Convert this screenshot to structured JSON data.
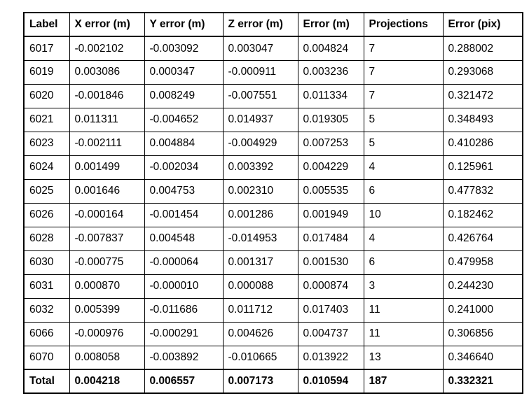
{
  "table": {
    "columns": [
      "Label",
      "X error (m)",
      "Y error (m)",
      "Z error (m)",
      "Error (m)",
      "Projections",
      "Error (pix)"
    ],
    "rows": [
      [
        "6017",
        "-0.002102",
        "-0.003092",
        "0.003047",
        "0.004824",
        "7",
        "0.288002"
      ],
      [
        "6019",
        "0.003086",
        "0.000347",
        "-0.000911",
        "0.003236",
        "7",
        "0.293068"
      ],
      [
        "6020",
        "-0.001846",
        "0.008249",
        "-0.007551",
        "0.011334",
        "7",
        "0.321472"
      ],
      [
        "6021",
        "0.011311",
        "-0.004652",
        "0.014937",
        "0.019305",
        "5",
        "0.348493"
      ],
      [
        "6023",
        "-0.002111",
        "0.004884",
        "-0.004929",
        "0.007253",
        "5",
        "0.410286"
      ],
      [
        "6024",
        "0.001499",
        "-0.002034",
        "0.003392",
        "0.004229",
        "4",
        "0.125961"
      ],
      [
        "6025",
        "0.001646",
        "0.004753",
        "0.002310",
        "0.005535",
        "6",
        "0.477832"
      ],
      [
        "6026",
        "-0.000164",
        "-0.001454",
        "0.001286",
        "0.001949",
        "10",
        "0.182462"
      ],
      [
        "6028",
        "-0.007837",
        "0.004548",
        "-0.014953",
        "0.017484",
        "4",
        "0.426764"
      ],
      [
        "6030",
        "-0.000775",
        "-0.000064",
        "0.001317",
        "0.001530",
        "6",
        "0.479958"
      ],
      [
        "6031",
        "0.000870",
        "-0.000010",
        "0.000088",
        "0.000874",
        "3",
        "0.244230"
      ],
      [
        "6032",
        "0.005399",
        "-0.011686",
        "0.011712",
        "0.017403",
        "11",
        "0.241000"
      ],
      [
        "6066",
        "-0.000976",
        "-0.000291",
        "0.004626",
        "0.004737",
        "11",
        "0.306856"
      ],
      [
        "6070",
        "0.008058",
        "-0.003892",
        "-0.010665",
        "0.013922",
        "13",
        "0.346640"
      ]
    ],
    "total_row": [
      "Total",
      "0.004218",
      "0.006557",
      "0.007173",
      "0.010594",
      "187",
      "0.332321"
    ]
  }
}
